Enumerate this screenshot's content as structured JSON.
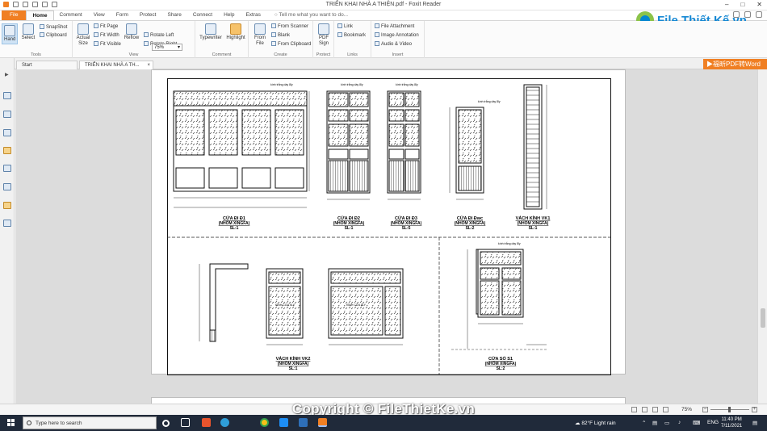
{
  "window": {
    "title": "TRIỂN KHAI NHÀ A THIỆN.pdf - Foxit Reader"
  },
  "menu": {
    "items": [
      "File",
      "Home",
      "Comment",
      "View",
      "Form",
      "Protect",
      "Share",
      "Connect",
      "Help",
      "Extras"
    ],
    "active": "Home",
    "tell_me": "Tell me what you want to do..."
  },
  "logo": {
    "text": "File Thiết Kế.vn"
  },
  "ribbon": {
    "tools": {
      "hand": "Hand",
      "select": "Select",
      "snapshot": "SnapShot",
      "clipboard": "Clipboard",
      "label": "Tools"
    },
    "view": {
      "actual_size": "Actual Size",
      "fit_page": "Fit Page",
      "fit_width": "Fit Width",
      "fit_visible": "Fit Visible",
      "reflow": "Reflow",
      "zoom": "75%",
      "rotate_left": "Rotate Left",
      "rotate_right": "Rotate Right",
      "label": "View"
    },
    "comment": {
      "typewriter": "Typewriter",
      "highlight": "Highlight",
      "label": "Comment"
    },
    "create": {
      "from_file": "From File",
      "from_scanner": "From Scanner",
      "blank": "Blank",
      "from_clipboard": "From Clipboard",
      "label": "Create"
    },
    "protect": {
      "pdf_sign": "PDF Sign",
      "label": "Protect"
    },
    "links": {
      "link": "Link",
      "bookmark": "Bookmark",
      "label": "Links"
    },
    "insert": {
      "file_attachment": "File Attachment",
      "image_annotation": "Image Annotation",
      "audio_video": "Audio & Video",
      "label": "Insert"
    }
  },
  "tabs": [
    {
      "label": "Start"
    },
    {
      "label": "TRIỂN KHAI NHÀ A TH..."
    }
  ],
  "to_word": "福昕PDF转Word",
  "drawing": {
    "note": "kính trắng dày 8ly",
    "vertical_note": "KÍNH CỬA 5LY",
    "panels": [
      {
        "title": "CỬA ĐI Đ1",
        "material": "(NHÔM XINGFA)",
        "scale": "SL:1"
      },
      {
        "title": "CỬA ĐI Đ2",
        "material": "(NHÔM XINGFA)",
        "scale": "SL:1"
      },
      {
        "title": "CỬA ĐI Đ3",
        "material": "(NHÔM XINGFA)",
        "scale": "SL:5"
      },
      {
        "title": "CỬA ĐI Đwc",
        "material": "(NHÔM XINGFA)",
        "scale": "SL:2"
      },
      {
        "title": "VÁCH KÍNH VK1",
        "material": "(NHÔM XINGFA)",
        "scale": "SL:1"
      },
      {
        "title": "VÁCH KÍNH VK2",
        "material": "(NHÔM XINGFA)",
        "scale": "SL:1"
      },
      {
        "title": "CỬA SỔ S1",
        "material": "(NHÔM XINGFA)",
        "scale": "SL:2"
      }
    ]
  },
  "status": {
    "zoom": "75%"
  },
  "copyright": "Copyright © FileThietKe.vn",
  "taskbar": {
    "search_placeholder": "Type here to search",
    "weather": "82°F  Light rain",
    "lang": "ENG",
    "time": "11:40 PM",
    "date": "7/11/2021"
  }
}
